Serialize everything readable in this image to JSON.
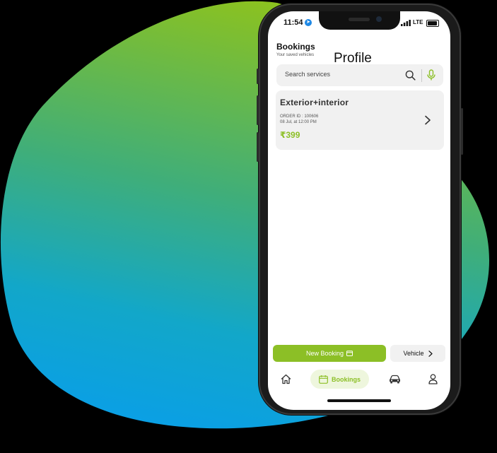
{
  "status_bar": {
    "time": "11:54",
    "network": "LTE"
  },
  "header": {
    "title": "Bookings",
    "subtitle": "Your saved vehicles"
  },
  "overlay_label": "Profile",
  "search": {
    "placeholder": "Search services"
  },
  "bookings": [
    {
      "service": "Exterior+interior",
      "order_id": "ORDER ID : 100606",
      "datetime": "08 Jul, at 12:00 PM",
      "price": "₹399"
    }
  ],
  "actions": {
    "new_booking": "New Booking",
    "vehicle": "Vehicle"
  },
  "bottom_nav": [
    {
      "id": "home",
      "icon": "home-icon"
    },
    {
      "id": "bookings",
      "icon": "calendar-icon",
      "label": "Bookings",
      "active": true
    },
    {
      "id": "vehicles",
      "icon": "car-icon"
    },
    {
      "id": "profile",
      "icon": "user-icon"
    }
  ],
  "colors": {
    "accent": "#8cbf26",
    "surface": "#f1f1f1",
    "nav_active_bg": "#eef6dd"
  }
}
